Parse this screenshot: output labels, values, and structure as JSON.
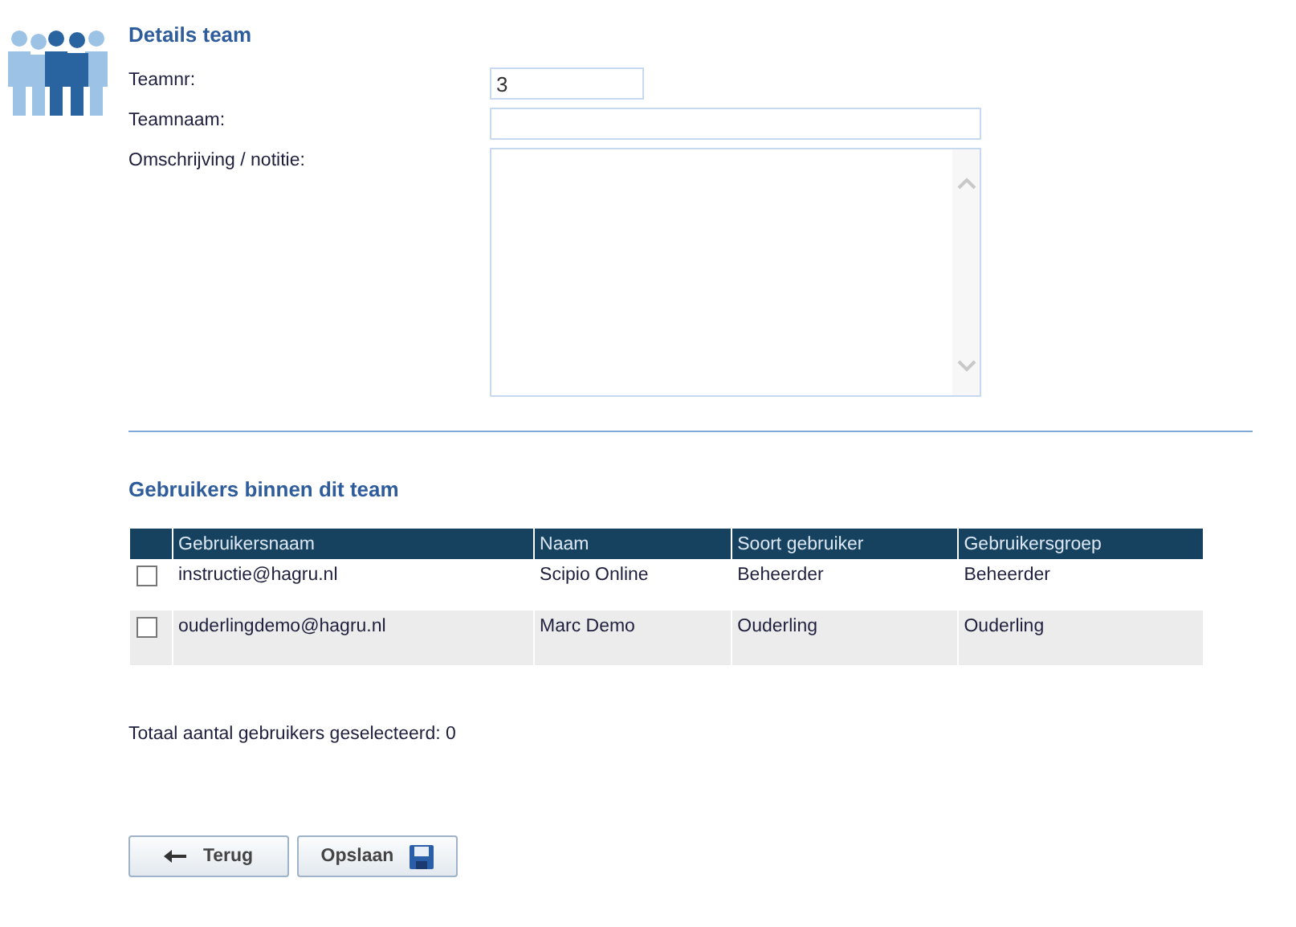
{
  "details": {
    "title": "Details team",
    "fields": [
      {
        "label": "Teamnr:",
        "value": "3",
        "kind": "short"
      },
      {
        "label": "Teamnaam:",
        "kind": "wide"
      },
      {
        "label": "Omschrijving / notitie:",
        "kind": "textarea"
      }
    ]
  },
  "users": {
    "title": "Gebruikers binnen dit team",
    "columns": [
      "Gebruikersnaam",
      "Naam",
      "Soort gebruiker",
      "Gebruikersgroep"
    ],
    "rows": [
      {
        "checked": false,
        "cells": [
          "instructie@hagru.nl",
          "Scipio Online",
          "Beheerder",
          "Beheerder"
        ]
      },
      {
        "checked": false,
        "cells": [
          "ouderlingdemo@hagru.nl",
          "Marc Demo",
          "Ouderling",
          "Ouderling"
        ]
      }
    ],
    "total": "Totaal aantal gebruikers geselecteerd: 0"
  },
  "buttons": [
    {
      "label": "Terug",
      "kind": "back"
    },
    {
      "label": "Opslaan",
      "kind": "save"
    }
  ]
}
